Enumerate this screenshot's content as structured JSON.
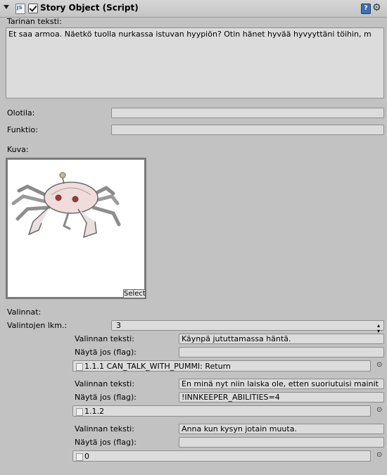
{
  "component": {
    "title": "Story Object (Script)",
    "enabled": true
  },
  "story": {
    "text_label": "Tarinan teksti:",
    "text_value": "Et saa armoa. Näetkö tuolla nurkassa istuvan hyypiön? Otin hänet hyvää hyvyyttäni töihin, m"
  },
  "olotila": {
    "label": "Olotila:",
    "value": ""
  },
  "funktio": {
    "label": "Funktio:",
    "value": ""
  },
  "kuva": {
    "label": "Kuva:",
    "select_label": "Select"
  },
  "valinnat": {
    "label": "Valinnat:",
    "count_label": "Valintojen lkm.:",
    "count_value": "3",
    "items": [
      {
        "text_label": "Valinnan teksti:",
        "text_value": "Käynpä jututtamassa häntä.",
        "flag_label": "Näytä jos (flag):",
        "flag_value": "",
        "target": "1.1.1 CAN_TALK_WITH_PUMMI: Return"
      },
      {
        "text_label": "Valinnan teksti:",
        "text_value": "En minä nyt niin laiska ole, etten suoriutuisi mainit",
        "flag_label": "Näytä jos (flag):",
        "flag_value": "!INNKEEPER_ABILITIES=4",
        "target": "1.1.2"
      },
      {
        "text_label": "Valinnan teksti:",
        "text_value": "Anna kun kysyn jotain muuta.",
        "flag_label": "Näytä jos (flag):",
        "flag_value": "",
        "target": "0"
      }
    ]
  },
  "icons": {
    "foldout": "foldout-arrow-icon",
    "script": "script-icon",
    "help": "help-icon",
    "gear": "gear-icon",
    "picker": "object-picker-icon"
  }
}
